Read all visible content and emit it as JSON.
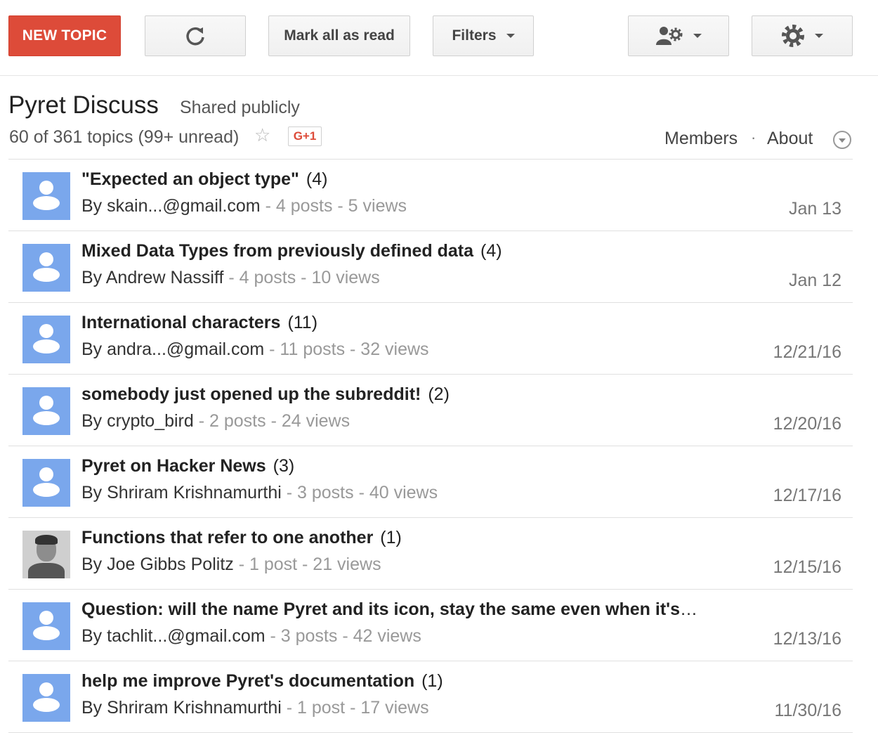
{
  "toolbar": {
    "new_topic": "NEW TOPIC",
    "refresh_icon": "refresh-icon",
    "mark_all_read": "Mark all as read",
    "filters": "Filters",
    "members_icon": "members-settings-icon",
    "settings_icon": "gear-icon",
    "accent_color": "#dd4b39"
  },
  "header": {
    "group_name": "Pyret Discuss",
    "visibility": "Shared publicly",
    "topic_count": "60 of 361 topics (99+ unread)",
    "star": "☆",
    "gplus": "G+1",
    "members": "Members",
    "separator": "·",
    "about": "About"
  },
  "topics": [
    {
      "title": "\"Expected an object type\"",
      "count": "(4)",
      "author": "By skain...@gmail.com",
      "stats": " - 4 posts - 5 views",
      "date": "Jan 13",
      "avatar": "default"
    },
    {
      "title": "Mixed Data Types from previously defined data",
      "count": "(4)",
      "author": "By Andrew Nassiff",
      "stats": " - 4 posts - 10 views",
      "date": "Jan 12",
      "avatar": "default"
    },
    {
      "title": "International characters",
      "count": "(11)",
      "author": "By andra...@gmail.com",
      "stats": " - 11 posts - 32 views",
      "date": "12/21/16",
      "avatar": "default"
    },
    {
      "title": "somebody just opened up the subreddit!",
      "count": "(2)",
      "author": "By crypto_bird",
      "stats": " - 2 posts - 24 views",
      "date": "12/20/16",
      "avatar": "default"
    },
    {
      "title": "Pyret on Hacker News",
      "count": "(3)",
      "author": "By Shriram Krishnamurthi",
      "stats": " - 3 posts - 40 views",
      "date": "12/17/16",
      "avatar": "default"
    },
    {
      "title": "Functions that refer to one another",
      "count": "(1)",
      "author": "By Joe Gibbs Politz",
      "stats": " - 1 post - 21 views",
      "date": "12/15/16",
      "avatar": "photo"
    },
    {
      "title": "Question: will the name Pyret and its icon, stay the same even when it's released",
      "count": "",
      "author": "By tachlit...@gmail.com",
      "stats": " - 3 posts - 42 views",
      "date": "12/13/16",
      "avatar": "default"
    },
    {
      "title": "help me improve Pyret's documentation",
      "count": "(1)",
      "author": "By Shriram Krishnamurthi",
      "stats": " - 1 post - 17 views",
      "date": "11/30/16",
      "avatar": "default"
    }
  ]
}
